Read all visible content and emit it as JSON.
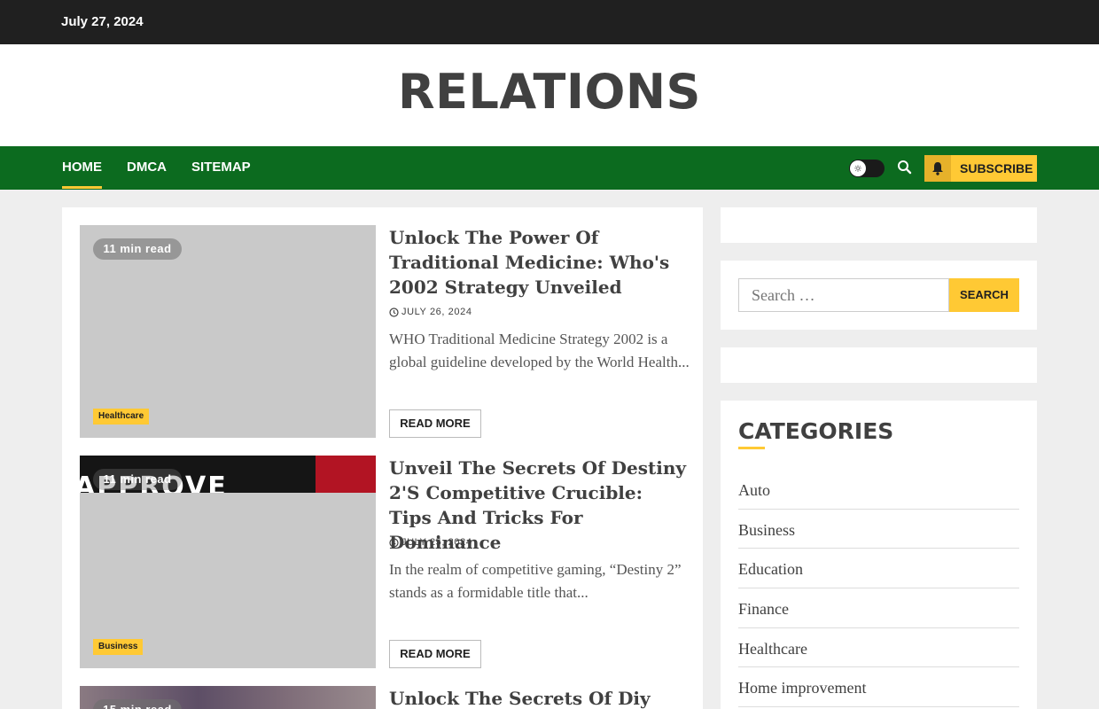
{
  "topbar": {
    "date": "July 27, 2024"
  },
  "site": {
    "title": "RELATIONS"
  },
  "nav": {
    "items": [
      {
        "label": "Home"
      },
      {
        "label": "DMCA"
      },
      {
        "label": "Sitemap"
      }
    ],
    "subscribe_label": "Subscribe",
    "icons": [
      "sun-icon",
      "search-icon",
      "bell-icon"
    ]
  },
  "colors": {
    "accent": "#ffc934",
    "nav": "#0c6b1f",
    "topbar": "#202020"
  },
  "posts": [
    {
      "read_time": "11 min read",
      "category": "Healthcare",
      "title": "Unlock The Power Of Traditional Medicine: Who's 2002 Strategy Unveiled",
      "date": "July 26, 2024",
      "excerpt": "WHO Traditional Medicine Strategy 2002 is a global guideline developed by the World Health...",
      "read_more": "Read More"
    },
    {
      "read_time": "11 min read",
      "category": "Business",
      "title": "Unveil The Secrets Of Destiny 2'S Competitive Crucible: Tips And Tricks For Dominance",
      "date": "July 25, 2024",
      "excerpt": "In the realm of competitive gaming, “Destiny 2” stands as a formidable title that...",
      "read_more": "Read More",
      "image_text": "APPROVE"
    },
    {
      "read_time": "15 min read",
      "title": "Unlock The Secrets Of Diy"
    }
  ],
  "sidebar": {
    "search": {
      "placeholder": "Search …",
      "button": "Search"
    },
    "categories": {
      "heading": "Categories",
      "items": [
        "Auto",
        "Business",
        "Education",
        "Finance",
        "Healthcare",
        "Home improvement"
      ]
    }
  }
}
